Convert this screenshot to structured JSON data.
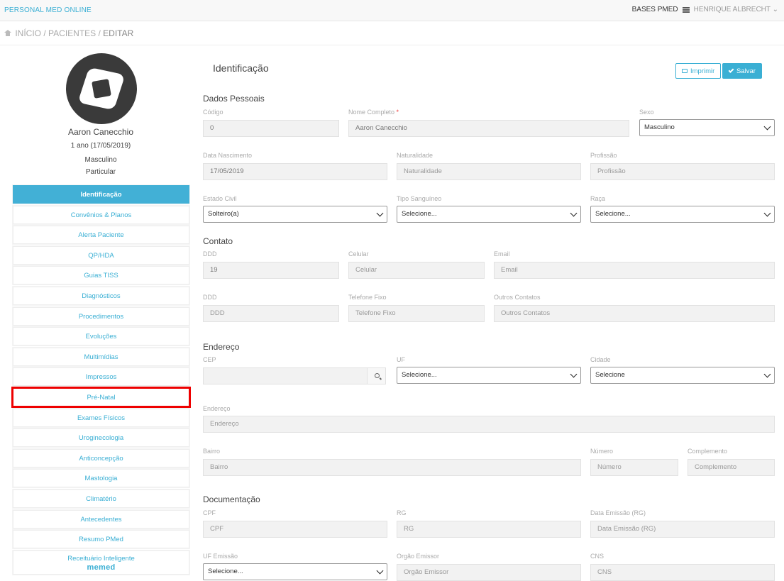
{
  "app": {
    "brand": "PERSONAL MED ONLINE",
    "bases": "BASES PMED",
    "user": "HENRIQUE ALBRECHT"
  },
  "breadcrumb": {
    "home": "INÍCIO",
    "sep1": " / ",
    "patients": "PACIENTES",
    "sep2": " / ",
    "current": "EDITAR"
  },
  "patient": {
    "name": "Aaron Canecchio",
    "age": "1 ano (17/05/2019)",
    "sex": "Masculino",
    "plan": "Particular"
  },
  "menu": {
    "items": [
      "Identificação",
      "Convênios & Planos",
      "Alerta Paciente",
      "QP/HDA",
      "Guias TISS",
      "Diagnósticos",
      "Procedimentos",
      "Evoluções",
      "Multimídias",
      "Impressos",
      "Pré-Natal",
      "Exames Físicos",
      "Uroginecologia",
      "Anticoncepção",
      "Mastologia",
      "Climatério",
      "Antecedentes",
      "Resumo PMed",
      "Receituário Inteligente"
    ],
    "memed": "memed"
  },
  "page": {
    "title": "Identificação",
    "print": "Imprimir",
    "save": "Salvar"
  },
  "sections": {
    "personal": "Dados Pessoais",
    "contact": "Contato",
    "address": "Endereço",
    "docs": "Documentação"
  },
  "fields": {
    "codigo": {
      "label": "Código",
      "value": "0"
    },
    "nome": {
      "label": "Nome Completo",
      "req": "*",
      "value": "Aaron Canecchio"
    },
    "sexo": {
      "label": "Sexo",
      "value": "Masculino"
    },
    "nascimento": {
      "label": "Data Nascimento",
      "value": "17/05/2019"
    },
    "naturalidade": {
      "label": "Naturalidade",
      "placeholder": "Naturalidade"
    },
    "profissao": {
      "label": "Profissão",
      "placeholder": "Profissão"
    },
    "estado_civil": {
      "label": "Estado Civil",
      "value": "Solteiro(a)"
    },
    "tipo_sanguineo": {
      "label": "Tipo Sanguíneo",
      "value": "Selecione..."
    },
    "raca": {
      "label": "Raça",
      "value": "Selecione..."
    },
    "ddd": {
      "label": "DDD",
      "value": "19"
    },
    "celular": {
      "label": "Celular",
      "placeholder": "Celular"
    },
    "email": {
      "label": "Email",
      "placeholder": "Email"
    },
    "ddd2": {
      "label": "DDD",
      "placeholder": "DDD"
    },
    "telefone": {
      "label": "Telefone Fixo",
      "placeholder": "Telefone Fixo"
    },
    "outros": {
      "label": "Outros Contatos",
      "placeholder": "Outros Contatos"
    },
    "cep": {
      "label": "CEP",
      "placeholder": ""
    },
    "uf": {
      "label": "UF",
      "value": "Selecione..."
    },
    "cidade": {
      "label": "Cidade",
      "value": "Selecione"
    },
    "endereco": {
      "label": "Endereço",
      "placeholder": "Endereço"
    },
    "bairro": {
      "label": "Bairro",
      "placeholder": "Bairro"
    },
    "numero": {
      "label": "Número",
      "placeholder": "Número"
    },
    "complemento": {
      "label": "Complemento",
      "placeholder": "Complemento"
    },
    "cpf": {
      "label": "CPF",
      "placeholder": "CPF"
    },
    "rg": {
      "label": "RG",
      "placeholder": "RG"
    },
    "emissao": {
      "label": "Data Emissão (RG)",
      "placeholder": "Data Emissão (RG)"
    },
    "uf_emissao": {
      "label": "UF Emissão",
      "value": "Selecione..."
    },
    "orgao": {
      "label": "Orgão Emissor",
      "placeholder": "Orgão Emissor"
    },
    "cns": {
      "label": "CNS",
      "placeholder": "CNS"
    }
  }
}
